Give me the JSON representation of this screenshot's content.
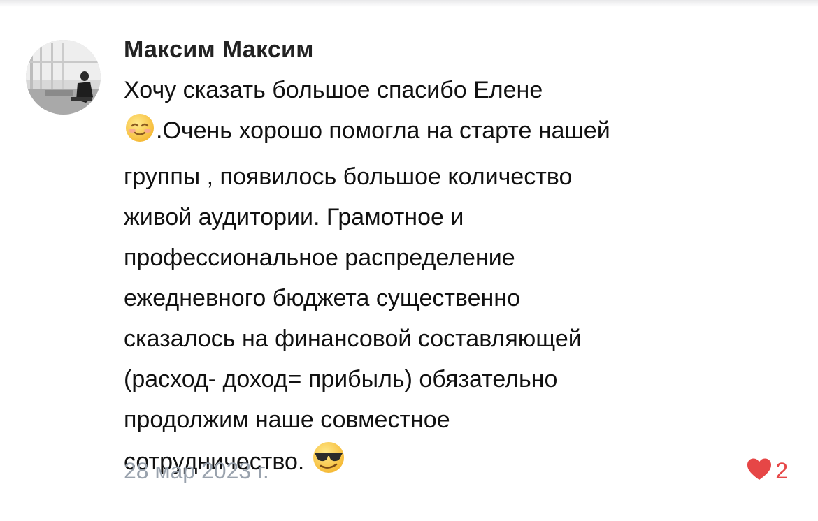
{
  "comment": {
    "author": "Максим Максим",
    "text_lines": [
      "Хочу сказать большое спасибо Елене",
      ".Очень хорошо помогла на старте нашей",
      "группы , появилось большое количество",
      "живой аудитории. Грамотное и",
      "профессиональное распределение",
      "ежедневного бюджета существенно",
      "сказалось на финансовой составляющей",
      "(расход- доход= прибыль) обязательно",
      "продолжим наше совместное",
      "сотрудничество."
    ],
    "emojis": [
      "smiling-blushing-face",
      "sunglasses-face"
    ],
    "date": "28 мар 2023 г.",
    "likes": {
      "count": "2",
      "color": "#e64646",
      "icon": "heart-icon"
    }
  }
}
